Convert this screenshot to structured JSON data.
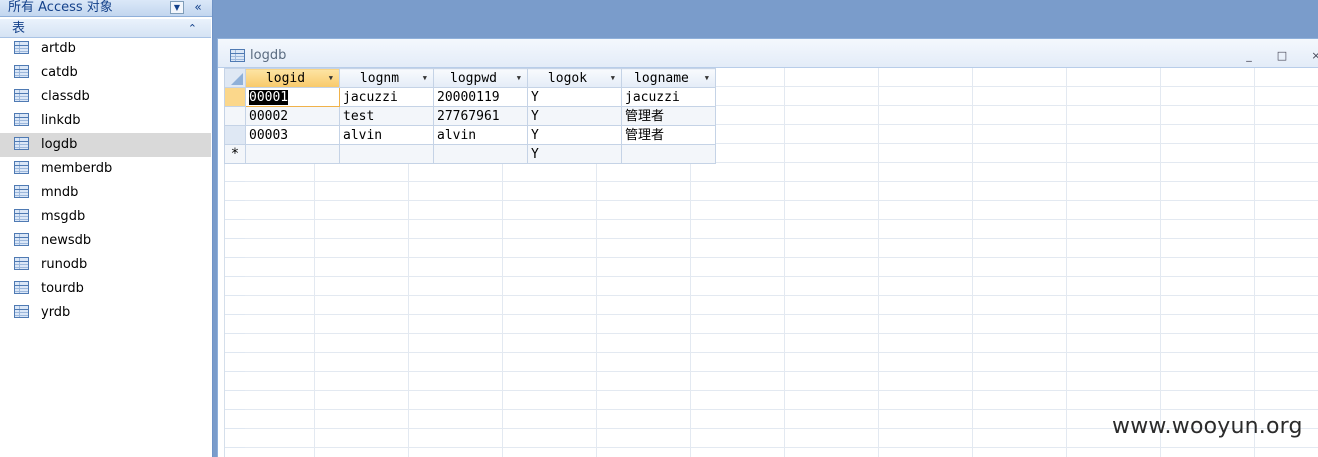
{
  "nav": {
    "title": "所有 Access 对象",
    "dropdown_icon": "chevron-down-icon",
    "collapse_icon": "double-chevron-left-icon",
    "group_label": "表",
    "group_toggle": "double-chevron-up-icon",
    "items": [
      {
        "label": "artdb"
      },
      {
        "label": "catdb"
      },
      {
        "label": "classdb"
      },
      {
        "label": "linkdb"
      },
      {
        "label": "logdb",
        "selected": true
      },
      {
        "label": "memberdb"
      },
      {
        "label": "mndb"
      },
      {
        "label": "msgdb"
      },
      {
        "label": "newsdb"
      },
      {
        "label": "runodb"
      },
      {
        "label": "tourdb"
      },
      {
        "label": "yrdb"
      }
    ]
  },
  "document": {
    "title": "logdb",
    "min_glyph": "_",
    "max_glyph": "□",
    "close_glyph": "×"
  },
  "datasheet": {
    "columns": [
      "logid",
      "lognm",
      "logpwd",
      "logok",
      "logname"
    ],
    "rows": [
      [
        "00001",
        "jacuzzi",
        "20000119",
        "Y",
        "jacuzzi"
      ],
      [
        "00002",
        "test",
        "27767961",
        "Y",
        "管理者"
      ],
      [
        "00003",
        "alvin",
        "alvin",
        "Y",
        "管理者"
      ]
    ],
    "new_row_marker": "*",
    "new_row": [
      "",
      "",
      "",
      "Y",
      ""
    ]
  },
  "watermark": "www.wooyun.org"
}
